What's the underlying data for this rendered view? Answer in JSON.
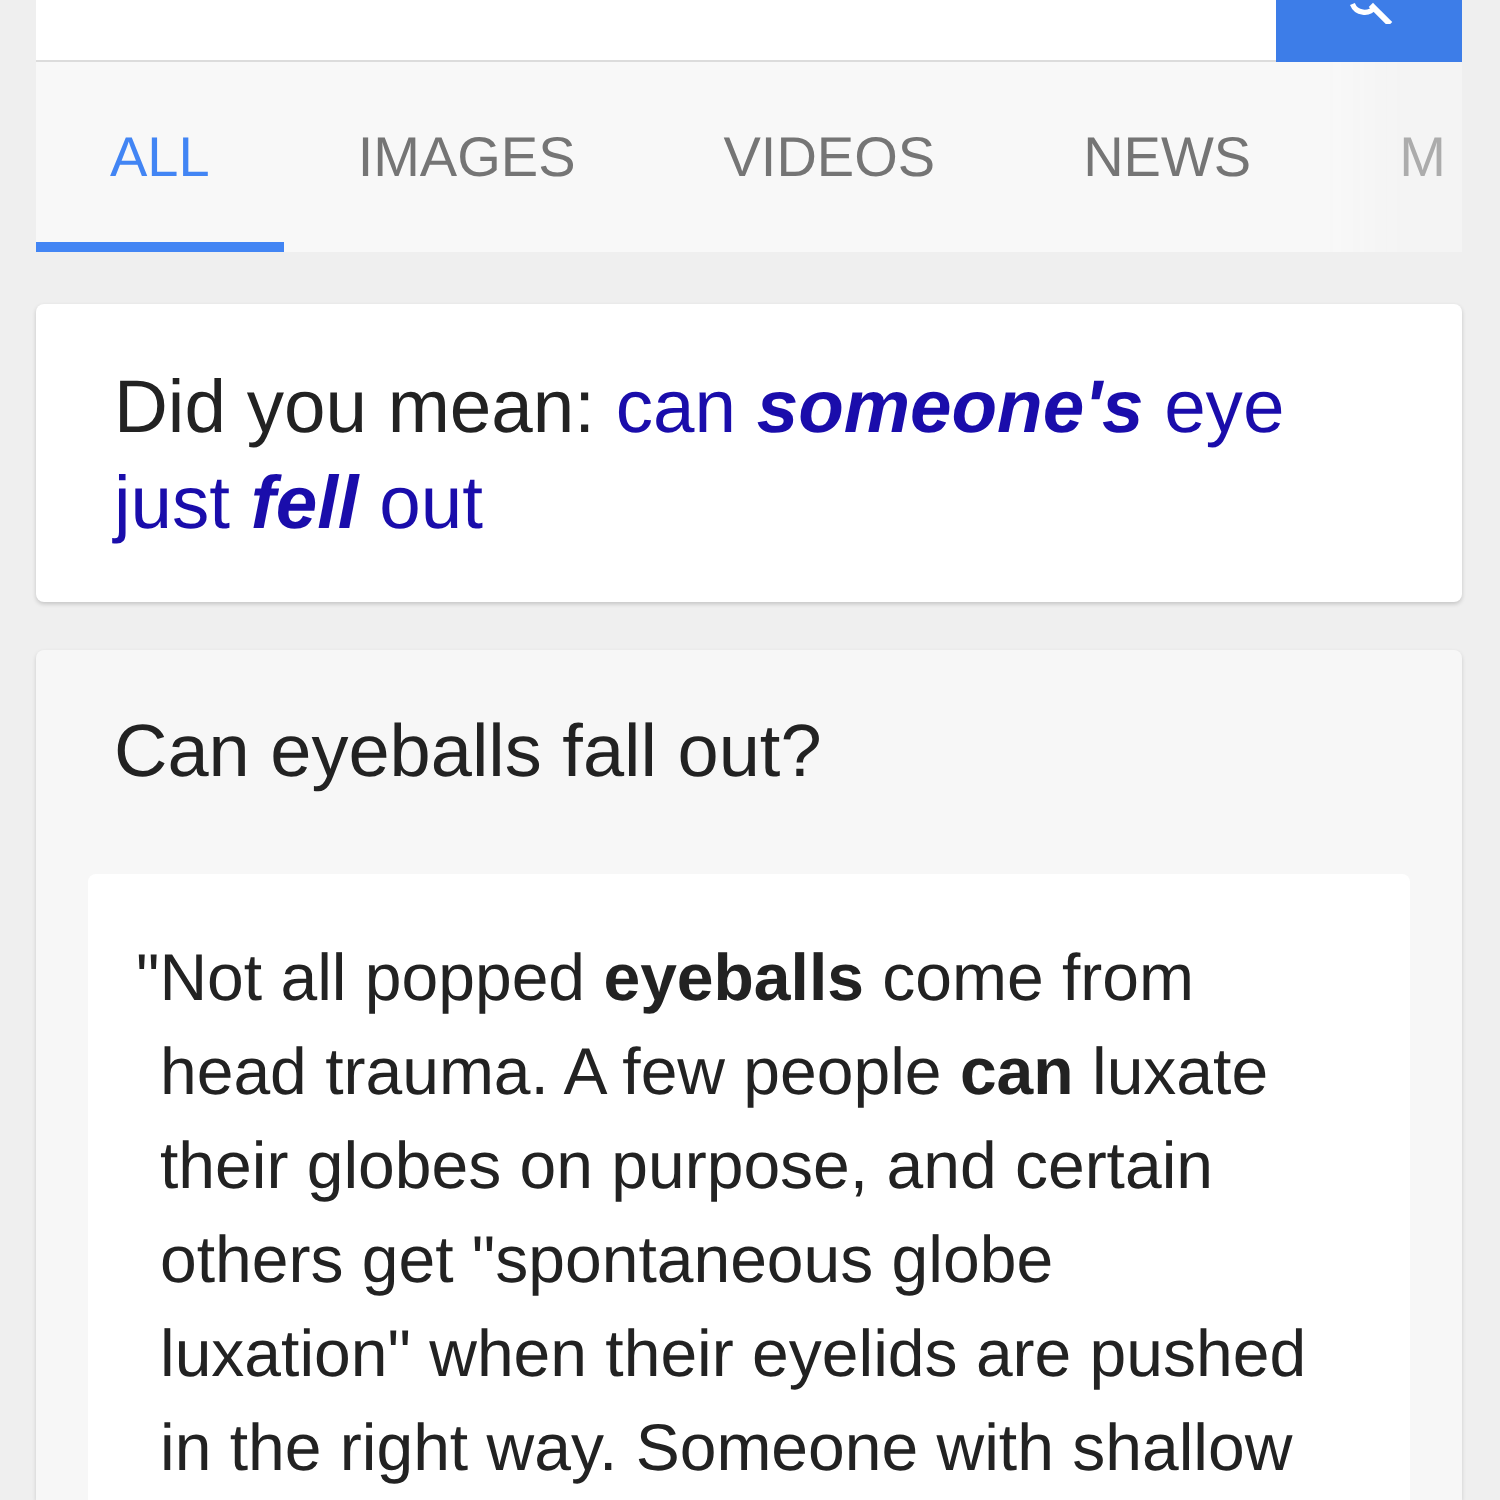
{
  "tabs": [
    {
      "label": "ALL",
      "selected": true
    },
    {
      "label": "IMAGES",
      "selected": false
    },
    {
      "label": "VIDEOS",
      "selected": false
    },
    {
      "label": "NEWS",
      "selected": false
    },
    {
      "label": "M",
      "selected": false
    }
  ],
  "suggestion": {
    "label": "Did you mean:",
    "query": "can **someone's** eye just **fell** out"
  },
  "answer_card": {
    "title": "Can eyeballs fall out?",
    "snippet": "\"Not all popped **eyeballs** come from head trauma. A few people **can** luxate their globes on purpose, and certain others get \"spontaneous globe luxation\" when their eyelids are pushed in the right way. Someone with shallow"
  }
}
